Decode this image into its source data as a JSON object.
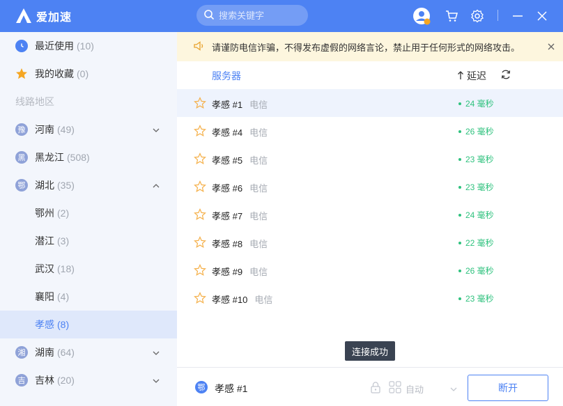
{
  "app": {
    "name": "爱加速"
  },
  "search": {
    "placeholder": "搜索关键字"
  },
  "colors": {
    "brand": "#4d82f3",
    "sidebar_bg": "#f3f6fc",
    "latency_good": "#2fc27e",
    "notice_bg": "#fdf6de"
  },
  "sidebar": {
    "recent": {
      "label": "最近使用",
      "count": "(10)",
      "icon": "clock-icon"
    },
    "favorites": {
      "label": "我的收藏",
      "count": "(0)",
      "icon": "star-icon"
    },
    "section_title": "线路地区",
    "provinces": [
      {
        "badge": "豫",
        "label": "河南",
        "count": "(49)",
        "expanded": false
      },
      {
        "badge": "黑",
        "label": "黑龙江",
        "count": "(508)"
      },
      {
        "badge": "鄂",
        "label": "湖北",
        "count": "(35)",
        "expanded": true
      },
      {
        "badge": "湘",
        "label": "湖南",
        "count": "(64)",
        "expanded": false
      },
      {
        "badge": "吉",
        "label": "吉林",
        "count": "(20)",
        "expanded": false
      }
    ],
    "cities": [
      {
        "label": "鄂州",
        "count": "(2)"
      },
      {
        "label": "潜江",
        "count": "(3)"
      },
      {
        "label": "武汉",
        "count": "(18)"
      },
      {
        "label": "襄阳",
        "count": "(4)"
      },
      {
        "label": "孝感",
        "count": "(8)",
        "active": true
      }
    ]
  },
  "notice": {
    "text": "请谨防电信诈骗，不得发布虚假的网络言论，禁止用于任何形式的网络攻击。"
  },
  "list": {
    "col_server": "服务器",
    "col_latency": "延迟",
    "rows": [
      {
        "name": "孝感 #1",
        "isp": "电信",
        "latency": "24 毫秒"
      },
      {
        "name": "孝感 #4",
        "isp": "电信",
        "latency": "26 毫秒"
      },
      {
        "name": "孝感 #5",
        "isp": "电信",
        "latency": "23 毫秒"
      },
      {
        "name": "孝感 #6",
        "isp": "电信",
        "latency": "23 毫秒"
      },
      {
        "name": "孝感 #7",
        "isp": "电信",
        "latency": "24 毫秒"
      },
      {
        "name": "孝感 #8",
        "isp": "电信",
        "latency": "22 毫秒"
      },
      {
        "name": "孝感 #9",
        "isp": "电信",
        "latency": "26 毫秒"
      },
      {
        "name": "孝感 #10",
        "isp": "电信",
        "latency": "23 毫秒"
      }
    ]
  },
  "toast": {
    "text": "连接成功"
  },
  "bottom": {
    "current_badge": "鄂",
    "current_name": "孝感 #1",
    "mode": "自动",
    "disconnect_label": "断开"
  }
}
